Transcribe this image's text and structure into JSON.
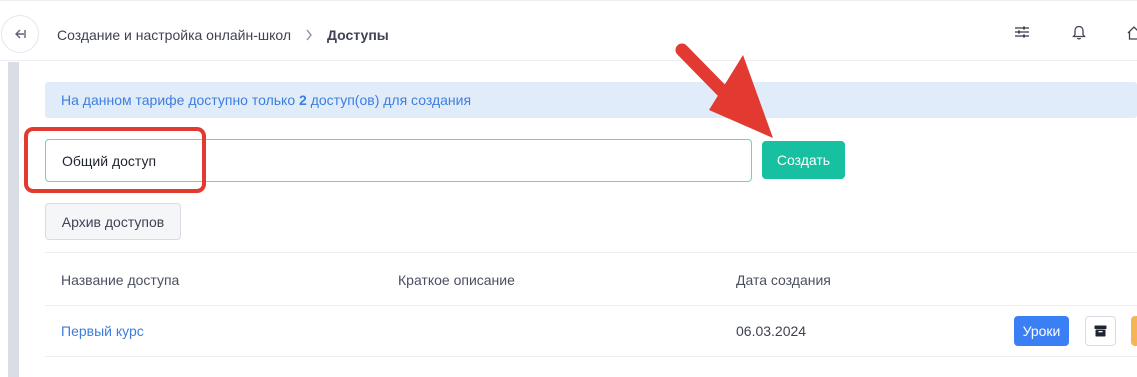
{
  "breadcrumb": {
    "parent": "Создание и настройка онлайн-школ",
    "current": "Доступы"
  },
  "icons": {
    "collapse": "collapse-sidebar-icon",
    "chevron": "chevron-right-icon",
    "settings": "sliders-icon",
    "notifications": "bell-icon",
    "home": "home-icon",
    "archive_row": "archive-box-icon"
  },
  "notice": {
    "text_before": "На данном тарифе доступно только ",
    "count": "2",
    "text_after": " доступ(ов) для создания"
  },
  "form": {
    "name_value": "Общий доступ",
    "create_label": "Создать"
  },
  "archive_button": "Архив доступов",
  "table": {
    "headers": [
      "Название доступа",
      "Краткое описание",
      "Дата создания"
    ],
    "rows": [
      {
        "name": "Первый курс",
        "description": "",
        "date": "06.03.2024",
        "lessons_label": "Уроки"
      }
    ]
  },
  "colors": {
    "accent_green": "#16c0a0",
    "link_blue": "#3d7de0",
    "notice_bg": "#e1ecfb",
    "primary_blue": "#3b7ff5",
    "annotation_red": "#e23a30"
  }
}
